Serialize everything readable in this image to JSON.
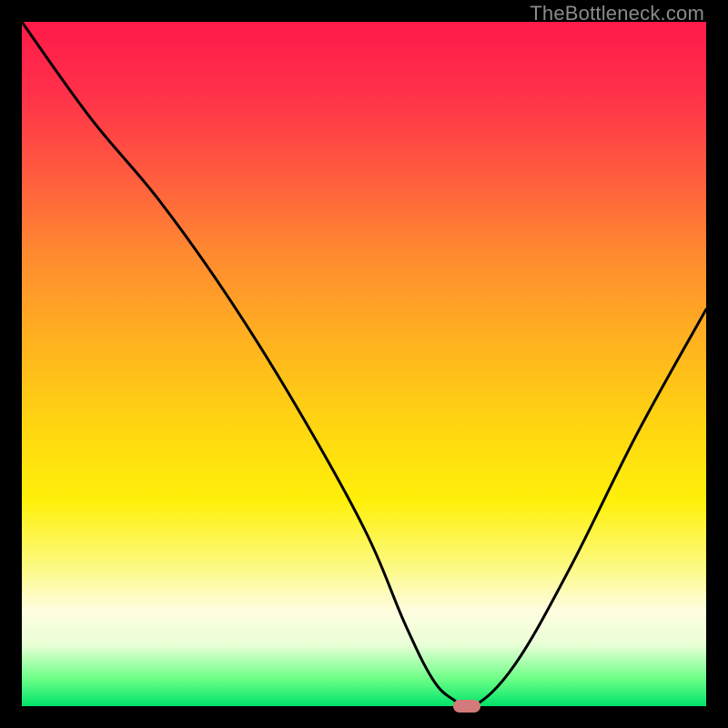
{
  "watermark": "TheBottleneck.com",
  "chart_data": {
    "type": "line",
    "title": "",
    "xlabel": "",
    "ylabel": "",
    "xlim": [
      0,
      100
    ],
    "ylim": [
      0,
      100
    ],
    "series": [
      {
        "name": "curve",
        "x": [
          0,
          10,
          20,
          30,
          40,
          50,
          56,
          60,
          63,
          66,
          72,
          80,
          90,
          100
        ],
        "y": [
          100,
          86,
          74,
          60,
          44,
          26,
          12,
          4,
          1,
          0,
          6,
          20,
          40,
          58
        ]
      }
    ],
    "marker": {
      "x": 65,
      "y": 0,
      "color": "#d37a7a"
    },
    "gradient_stops": [
      {
        "pos": 0,
        "color": "#ff1a4a"
      },
      {
        "pos": 10,
        "color": "#ff2f4a"
      },
      {
        "pos": 22,
        "color": "#ff5a3f"
      },
      {
        "pos": 34,
        "color": "#ff8a30"
      },
      {
        "pos": 46,
        "color": "#ffb020"
      },
      {
        "pos": 58,
        "color": "#ffd312"
      },
      {
        "pos": 70,
        "color": "#fff00a"
      },
      {
        "pos": 79,
        "color": "#fcf97a"
      },
      {
        "pos": 86,
        "color": "#fffde0"
      },
      {
        "pos": 91,
        "color": "#e9ffd6"
      },
      {
        "pos": 96,
        "color": "#6dff87"
      },
      {
        "pos": 100,
        "color": "#00e36a"
      }
    ]
  }
}
